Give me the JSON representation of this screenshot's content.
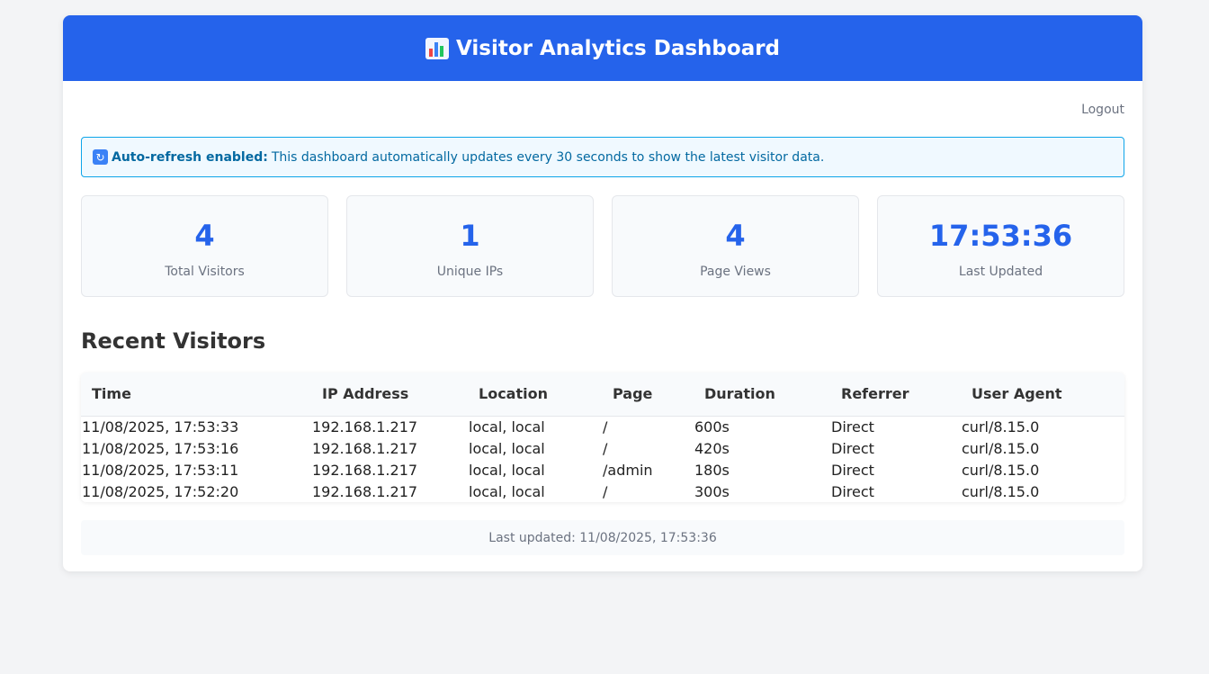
{
  "header": {
    "icon": "bar-chart-icon",
    "title": "Visitor Analytics Dashboard"
  },
  "nav": {
    "logout_label": "Logout"
  },
  "notice": {
    "icon": "refresh-icon",
    "bold_label": "Auto-refresh enabled:",
    "text": "This dashboard automatically updates every 30 seconds to show the latest visitor data."
  },
  "stats": [
    {
      "value": "4",
      "label": "Total Visitors"
    },
    {
      "value": "1",
      "label": "Unique IPs"
    },
    {
      "value": "4",
      "label": "Page Views"
    },
    {
      "value": "17:53:36",
      "label": "Last Updated"
    }
  ],
  "recent": {
    "title": "Recent Visitors",
    "columns": [
      "Time",
      "IP Address",
      "Location",
      "Page",
      "Duration",
      "Referrer",
      "User Agent"
    ],
    "rows": [
      [
        "11/08/2025, 17:53:33",
        "192.168.1.217",
        "local, local",
        "/",
        "600s",
        "Direct",
        "curl/8.15.0"
      ],
      [
        "11/08/2025, 17:53:16",
        "192.168.1.217",
        "local, local",
        "/",
        "420s",
        "Direct",
        "curl/8.15.0"
      ],
      [
        "11/08/2025, 17:53:11",
        "192.168.1.217",
        "local, local",
        "/admin",
        "180s",
        "Direct",
        "curl/8.15.0"
      ],
      [
        "11/08/2025, 17:52:20",
        "192.168.1.217",
        "local, local",
        "/",
        "300s",
        "Direct",
        "curl/8.15.0"
      ]
    ]
  },
  "footer": {
    "text": "Last updated: 11/08/2025, 17:53:36"
  },
  "colors": {
    "accent": "#2563eb",
    "notice_border": "#0ea5e9",
    "notice_bg": "#f0f9ff",
    "notice_text": "#0369a1",
    "page_bg": "#f3f4f6"
  }
}
